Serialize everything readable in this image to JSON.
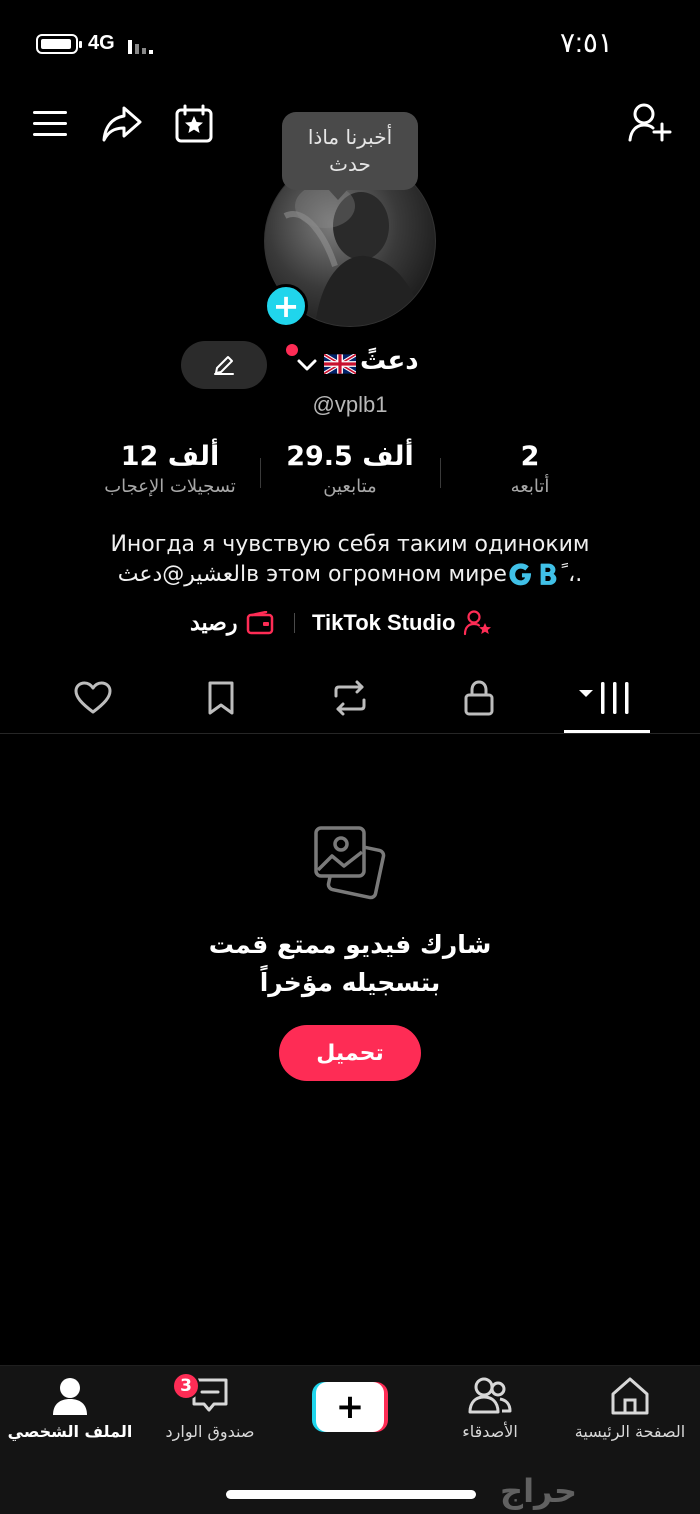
{
  "status_bar": {
    "time": "٧:٥١",
    "network": "4G"
  },
  "header": {
    "tooltip": "أخبرنا ماذا حدث",
    "icons": [
      "menu-icon",
      "share-icon",
      "calendar-star-icon",
      "add-friend-icon"
    ]
  },
  "profile": {
    "display_name": "دعثً",
    "username": "@vplb1",
    "flag": "🇬🇧"
  },
  "stats": [
    {
      "value": "2",
      "label": "أتابعه"
    },
    {
      "value": "29.5 ألف",
      "label": "متابعين"
    },
    {
      "value": "12 ألف",
      "label": "تسجيلات الإعجاب"
    }
  ],
  "bio": {
    "line1": "Иногда я чувствую себя таким одиноким",
    "line2": "العشير@دعثв этом огромном мире🇬🇧ً ،."
  },
  "links": {
    "studio": "TikTok Studio",
    "balance": "رصيد"
  },
  "tabs": [
    "videos-grid-icon",
    "lock-icon",
    "repost-icon",
    "bookmark-icon",
    "heart-icon"
  ],
  "empty_state": {
    "title": "شارك فيديو ممتع قمت بتسجيله مؤخراً",
    "button": "تحميل"
  },
  "bottom_nav": {
    "home": "الصفحة الرئيسية",
    "friends": "الأصدقاء",
    "create": "+",
    "inbox": "صندوق الوارد",
    "inbox_badge": "3",
    "profile": "الملف الشخصي"
  },
  "watermark": "حراج",
  "colors": {
    "accent": "#fe2c55",
    "cyan": "#20d5ec",
    "background": "#000000"
  }
}
